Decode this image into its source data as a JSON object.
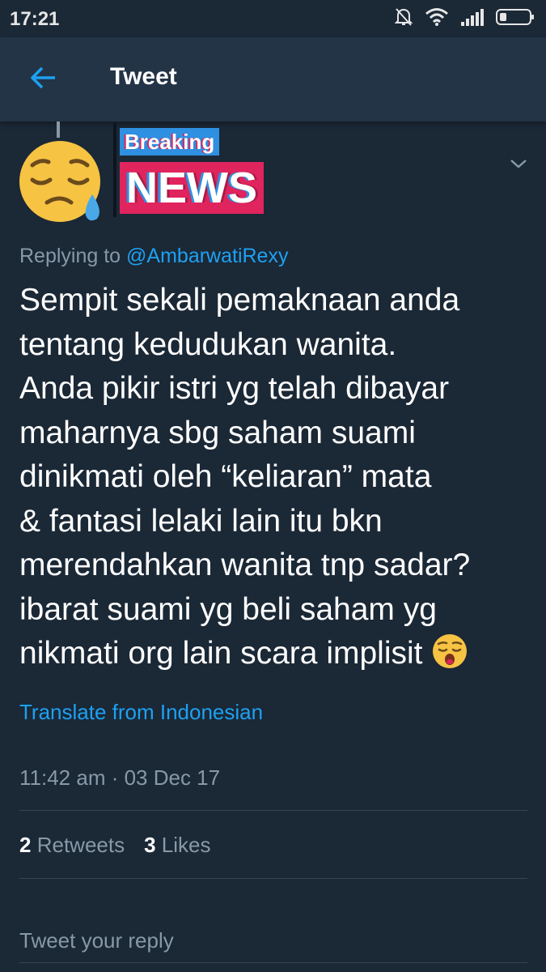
{
  "status_bar": {
    "time": "17:21",
    "icons": [
      "mute-bell-icon",
      "wifi-icon",
      "signal-icon",
      "battery-icon"
    ]
  },
  "app_bar": {
    "title": "Tweet",
    "back_icon": "back-arrow-icon"
  },
  "author": {
    "avatar_icon": "sleepy-face-emoji",
    "name_line1": "Breaking",
    "name_line2": "NEWS"
  },
  "tweet": {
    "replying_prefix": "Replying to",
    "replying_handle": "@AmbarwatiRexy",
    "text": "Sempit sekali pemaknaan anda\ntentang kedudukan wanita.\nAnda pikir istri yg telah dibayar\nmaharnya sbg saham suami\ndinikmati oleh “keliaran” mata\n& fantasi lelaki lain itu bkn\nmerendahkan wanita tnp sadar?\nibarat suami yg beli saham yg\nnikmati org lain scara implisit",
    "trailing_emoji": "yawning-face-emoji",
    "translate_label": "Translate from Indonesian",
    "timestamp": "11:42 am · 03 Dec 17"
  },
  "stats": {
    "retweets_count": "2",
    "retweets_label": "Retweets",
    "likes_count": "3",
    "likes_label": "Likes"
  },
  "reply": {
    "placeholder": "Tweet your reply"
  },
  "colors": {
    "background": "#1b2836",
    "app_bar": "#243447",
    "accent": "#1da1f2",
    "muted_text": "#8899a6",
    "divider": "#38444d"
  }
}
